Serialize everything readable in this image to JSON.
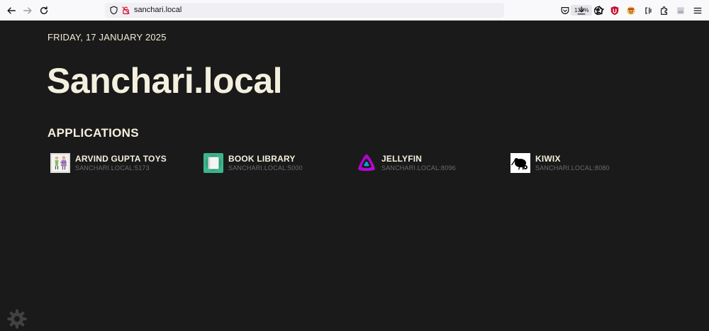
{
  "browser": {
    "url": "sanchari.local",
    "zoom": "133%",
    "icons": {
      "back": "back-arrow-icon",
      "forward": "forward-arrow-icon",
      "reload": "reload-icon",
      "shield": "tracking-protection-icon",
      "site": "site-info-icon",
      "bookmark": "bookmark-star-icon",
      "pocket": "pocket-icon",
      "downloads": "download-icon",
      "account": "account-icon",
      "ublock": "ublock-icon",
      "extension1": "extension-avatar-icon",
      "extension2": "extension-cl-icon",
      "extensions": "puzzle-icon",
      "sidebar": "sidebar-icon",
      "menu": "hamburger-menu-icon"
    }
  },
  "page": {
    "date": "FRIDAY, 17 JANUARY 2025",
    "title": "Sanchari.local",
    "section_title": "APPLICATIONS",
    "applications": [
      {
        "name": "ARVIND GUPTA TOYS",
        "url": "SANCHARI.LOCAL:5173",
        "icon": "arvind-gupta-toys-icon"
      },
      {
        "name": "BOOK LIBRARY",
        "url": "SANCHARI.LOCAL:5000",
        "icon": "book-library-icon"
      },
      {
        "name": "JELLYFIN",
        "url": "SANCHARI.LOCAL:8096",
        "icon": "jellyfin-icon"
      },
      {
        "name": "KIWIX",
        "url": "SANCHARI.LOCAL:8080",
        "icon": "kiwix-icon"
      }
    ],
    "settings_icon": "gear-icon"
  },
  "colors": {
    "background": "#1b1a1a",
    "heading": "#f4f0df",
    "muted": "#6d6d6d",
    "jellyfin_purple": "#aa00cc",
    "jellyfin_blue": "#00a4dc",
    "book_green": "#3cb48c"
  }
}
